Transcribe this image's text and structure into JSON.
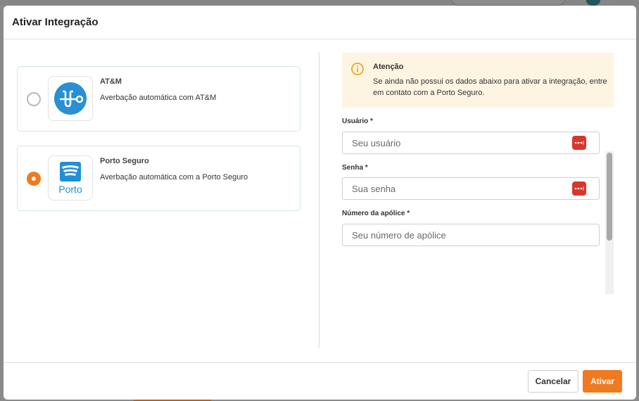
{
  "modal": {
    "title": "Ativar Integração"
  },
  "options": [
    {
      "name": "AT&M",
      "description": "Averbação automática com AT&M",
      "selected": false,
      "logo": "atm-logo"
    },
    {
      "name": "Porto Seguro",
      "description": "Averbação automática com a Porto Seguro",
      "selected": true,
      "logo": "porto-logo",
      "logo_text": "Porto"
    }
  ],
  "alert": {
    "icon": "info-icon",
    "title": "Atenção",
    "text": "Se ainda não possui os dados abaixo para ativar a integração, entre em contato com a Porto Seguro."
  },
  "form": {
    "username_label": "Usuário *",
    "username_placeholder": "Seu usuário",
    "password_label": "Senha *",
    "password_placeholder": "Sua senha",
    "policy_label": "Número da apólice *",
    "policy_placeholder": "Seu número de apólice"
  },
  "footer": {
    "cancel_label": "Cancelar",
    "activate_label": "Ativar"
  },
  "colors": {
    "accent": "#f07a20",
    "alert_bg": "#fef4e2",
    "password_manager": "#d9362b",
    "atm_blue": "#2a8fd4",
    "porto_blue": "#1f8fd9"
  }
}
